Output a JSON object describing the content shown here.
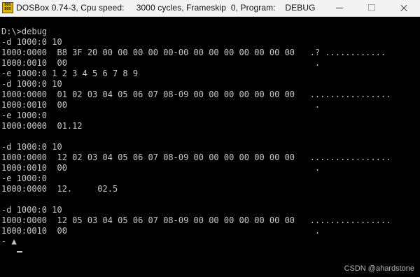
{
  "window": {
    "icon_text": "DOS BOX",
    "title": "DOSBox 0.74-3, Cpu speed:     3000 cycles, Frameskip  0, Program:    DEBUG"
  },
  "terminal": {
    "lines": [
      "D:\\>debug",
      "-d 1000:0 10",
      "1000:0000  B8 3F 20 00 00 00 00 00-00 00 00 00 00 00 00 00   .? ............",
      "1000:0010  00                                                 .",
      "-e 1000:0 1 2 3 4 5 6 7 8 9",
      "-d 1000:0 10",
      "1000:0000  01 02 03 04 05 06 07 08-09 00 00 00 00 00 00 00   ................",
      "1000:0010  00                                                 .",
      "-e 1000:0",
      "1000:0000  01.12",
      "",
      "-d 1000:0 10",
      "1000:0000  12 02 03 04 05 06 07 08-09 00 00 00 00 00 00 00   ................",
      "1000:0010  00                                                 .",
      "-e 1000:0",
      "1000:0000  12.     02.5",
      "",
      "-d 1000:0 10",
      "1000:0000  12 05 03 04 05 06 07 08-09 00 00 00 00 00 00 00   ................",
      "1000:0010  00                                                 .",
      "- ▲"
    ]
  },
  "watermark": "CSDN @ahardstone"
}
